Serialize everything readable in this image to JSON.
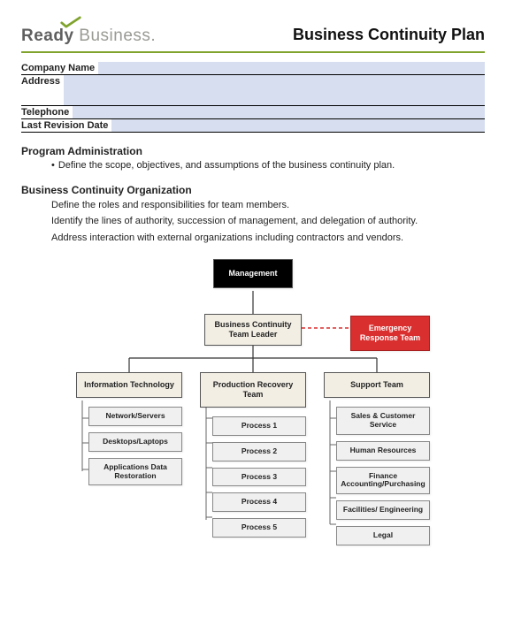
{
  "brand": {
    "strong": "Ready",
    "light": " Business."
  },
  "doc_title": "Business Continuity Plan",
  "form": {
    "company_label": "Company Name",
    "company_value": "",
    "address_label": "Address",
    "address_value": "",
    "telephone_label": "Telephone",
    "telephone_value": "",
    "revision_label": "Last Revision Date",
    "revision_value": ""
  },
  "sections": {
    "admin_title": "Program Administration",
    "admin_bullet": "Define the scope, objectives, and assumptions of the business continuity plan.",
    "org_title": "Business Continuity Organization",
    "org_line1": "Define the roles and responsibilities for team members.",
    "org_line2": "Identify the lines of authority, succession of management, and delegation of authority.",
    "org_line3": "Address interaction with external organizations including contractors and vendors."
  },
  "chart_data": {
    "type": "org-chart",
    "root": "Management",
    "leader": "Business Continuity Team Leader",
    "emergency": "Emergency Response Team",
    "columns": [
      {
        "head": "Information Technology",
        "items": [
          "Network/Servers",
          "Desktops/Laptops",
          "Applications Data Restoration"
        ]
      },
      {
        "head": "Production Recovery Team",
        "items": [
          "Process 1",
          "Process 2",
          "Process 3",
          "Process 4",
          "Process 5"
        ]
      },
      {
        "head": "Support Team",
        "items": [
          "Sales & Customer Service",
          "Human Resources",
          "Finance Accounting/Purchasing",
          "Facilities/ Engineering",
          "Legal"
        ]
      }
    ]
  }
}
